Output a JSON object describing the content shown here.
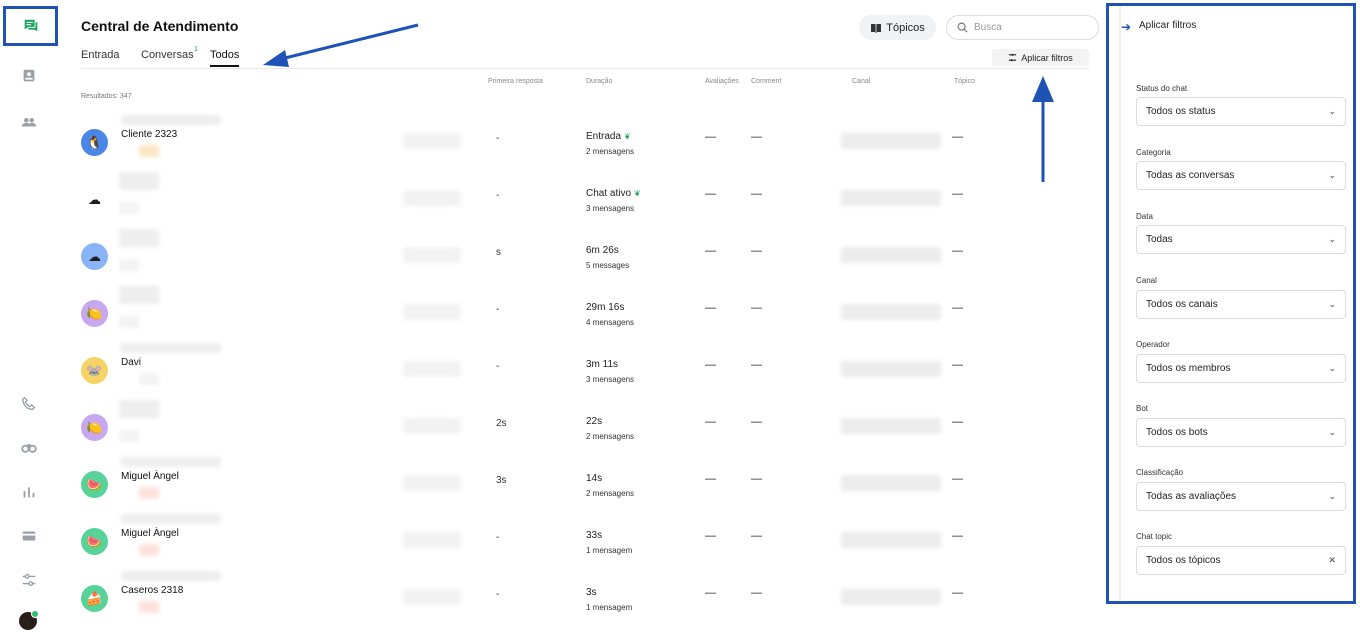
{
  "app": {
    "title": "Central de Atendimento"
  },
  "nav": {
    "items": [
      {
        "name": "nav-chats",
        "icon": "chat-bubbles-icon",
        "active": true
      },
      {
        "name": "nav-inbox",
        "icon": "inbox-icon"
      },
      {
        "name": "nav-contacts",
        "icon": "people-icon"
      },
      {
        "name": "nav-calls",
        "icon": "phone-icon"
      },
      {
        "name": "nav-monitor",
        "icon": "binoculars-icon"
      },
      {
        "name": "nav-reports",
        "icon": "bar-chart-icon"
      },
      {
        "name": "nav-billing",
        "icon": "credit-card-icon"
      },
      {
        "name": "nav-settings",
        "icon": "sliders-icon"
      }
    ]
  },
  "tabs": [
    {
      "label": "Entrada"
    },
    {
      "label": "Conversas",
      "count": "1"
    },
    {
      "label": "Todos",
      "active": true
    }
  ],
  "toolbar": {
    "topics_label": "Tópicos",
    "search_placeholder": "Busca",
    "apply_filters_label": "Aplicar filtros"
  },
  "table": {
    "results_label": "Resultados: 347",
    "columns": {
      "first_response": "Primeira resposta",
      "duration": "Duração",
      "ratings": "Avaliações",
      "comment": "Comment",
      "channel": "Canal",
      "topic": "Tópico"
    },
    "rows": [
      {
        "name": "Cliente 2323",
        "duration": "Entrada",
        "leaf": true,
        "messages": "2 mensagens",
        "first": "-",
        "ratings": "—",
        "comment": "—",
        "topic": "—",
        "avatar_bg": "#4a86e8",
        "avatar": "🐧"
      },
      {
        "name": "",
        "duration": "Chat ativo",
        "leaf": true,
        "messages": "3 mensagens",
        "first": "-",
        "ratings": "—",
        "comment": "—",
        "topic": "—",
        "avatar_bg": "transparent",
        "avatar": "☁"
      },
      {
        "name": "",
        "duration": "6m 26s",
        "leaf": false,
        "messages": "5 messages",
        "first": "s",
        "ratings": "—",
        "comment": "—",
        "topic": "—",
        "avatar_bg": "#8ab4f8",
        "avatar": "☁"
      },
      {
        "name": "",
        "duration": "29m 16s",
        "leaf": false,
        "messages": "4 mensagens",
        "first": "-",
        "ratings": "—",
        "comment": "—",
        "topic": "—",
        "avatar_bg": "#c6a7f0",
        "avatar": "🍋"
      },
      {
        "name": "Davi",
        "duration": "3m 11s",
        "leaf": false,
        "messages": "3 mensagens",
        "first": "-",
        "ratings": "—",
        "comment": "—",
        "topic": "—",
        "avatar_bg": "#f6d365",
        "avatar": "🐭"
      },
      {
        "name": "",
        "duration": "22s",
        "leaf": false,
        "messages": "2 mensagens",
        "first": "2s",
        "ratings": "—",
        "comment": "—",
        "topic": "—",
        "avatar_bg": "#c6a7f0",
        "avatar": "🍋"
      },
      {
        "name": "Miguel Àngel",
        "duration": "14s",
        "leaf": false,
        "messages": "2 mensagens",
        "first": "3s",
        "ratings": "—",
        "comment": "—",
        "topic": "—",
        "avatar_bg": "#57d39a",
        "avatar": "🍉"
      },
      {
        "name": "Miguel Àngel",
        "duration": "33s",
        "leaf": false,
        "messages": "1 mensagem",
        "first": "-",
        "ratings": "—",
        "comment": "—",
        "topic": "—",
        "avatar_bg": "#57d39a",
        "avatar": "🍉"
      },
      {
        "name": "Caseros 2318",
        "duration": "3s",
        "leaf": false,
        "messages": "1 mensagem",
        "first": "-",
        "ratings": "—",
        "comment": "—",
        "topic": "—",
        "avatar_bg": "#57d39a",
        "avatar": "🍰"
      }
    ]
  },
  "filters": {
    "title": "Aplicar filtros",
    "fields": [
      {
        "label": "Status do chat",
        "value": "Todos os status",
        "control": "chevron"
      },
      {
        "label": "Categoria",
        "value": "Todas as conversas",
        "control": "chevron"
      },
      {
        "label": "Data",
        "value": "Todas",
        "control": "chevron"
      },
      {
        "label": "Canal",
        "value": "Todos os canais",
        "control": "chevron"
      },
      {
        "label": "Operador",
        "value": "Todos os membros",
        "control": "chevron"
      },
      {
        "label": "Bot",
        "value": "Todos os bots",
        "control": "chevron"
      },
      {
        "label": "Classificação",
        "value": "Todas as avaliações",
        "control": "chevron"
      },
      {
        "label": "Chat topic",
        "value": "Todos os tópicos",
        "control": "clear"
      }
    ]
  },
  "colors": {
    "accent": "#1e53b5",
    "green": "#1aa260",
    "annotation": "#1e53b5"
  }
}
